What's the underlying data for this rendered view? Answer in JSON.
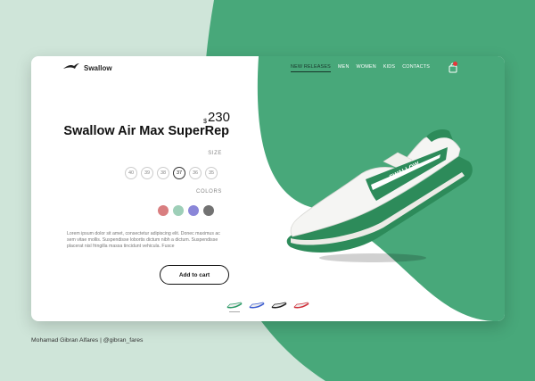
{
  "brand": {
    "name": "Swallow"
  },
  "nav": {
    "items": [
      {
        "label": "NEW RELEASES",
        "active": true
      },
      {
        "label": "MEN",
        "active": false
      },
      {
        "label": "WOMEN",
        "active": false
      },
      {
        "label": "KIDS",
        "active": false
      },
      {
        "label": "CONTACTS",
        "active": false
      }
    ]
  },
  "cart": {
    "icon": "shopping-bag-icon",
    "badge_color": "#e8363a"
  },
  "product": {
    "currency": "$",
    "price": "230",
    "title": "Swallow Air Max SuperRep",
    "size_label": "SIZE",
    "sizes": [
      "40",
      "39",
      "38",
      "37",
      "36",
      "35"
    ],
    "selected_size": "37",
    "colors_label": "COLORS",
    "colors": [
      "#d97e80",
      "#9ecfb8",
      "#8a86d8",
      "#727272"
    ],
    "description": "Lorem ipsum dolor sit amet, consectetur adipiscing elit. Donec maximus ac sem vitae mollis. Suspendisse lobortis dictum nibh a dictum. Suspendisse placerat nisl fringilla massa tincidunt vehicula. Fusce",
    "add_to_cart": "Add to cart",
    "shoe_text": "SWALLOW"
  },
  "thumbnails": [
    {
      "accent": "#2a9a66",
      "active": true
    },
    {
      "accent": "#3a5bd0",
      "active": false
    },
    {
      "accent": "#222222",
      "active": false
    },
    {
      "accent": "#d0303a",
      "active": false
    }
  ],
  "footer": {
    "credit": "Mohamad Gibran Alfares   |   @gibran_fares"
  },
  "colors": {
    "brand_green": "#48a87a",
    "page_bg": "#cfe5d9",
    "card_bg": "#ffffff"
  }
}
